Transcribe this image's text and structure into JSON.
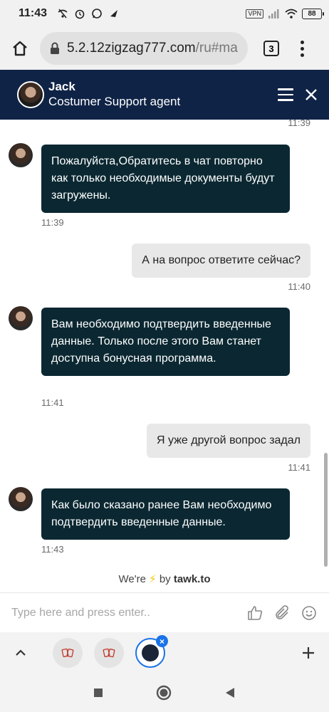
{
  "status_bar": {
    "time": "11:43",
    "vpn": "VPN",
    "battery": "88"
  },
  "browser": {
    "url_host": "5.2.12zigzag777.com",
    "url_path": "/ru#ma",
    "tab_count": "3"
  },
  "chat_header": {
    "agent_name": "Jack",
    "agent_role": "Costumer Support agent"
  },
  "messages": [
    {
      "from": "agent",
      "time": "11:39",
      "text": "Пожалуйста,Обратитесь в чат повторно как только необходимые документы будут загружены."
    },
    {
      "from": "user",
      "time": "11:40",
      "text": "А на вопрос ответите сейчас?"
    },
    {
      "from": "agent",
      "time": "11:41",
      "text": "Вам необходимо подтвердить введенные данные. Только после этого Вам станет доступна бонусная программа."
    },
    {
      "from": "user",
      "time": "11:41",
      "text": "Я уже другой вопрос задал"
    },
    {
      "from": "agent",
      "time": "11:43",
      "text": "Как было сказано ранее Вам необходимо подтвердить введенные данные."
    }
  ],
  "top_timestamp": "11:39",
  "powered_by": {
    "prefix": "We're",
    "by": "by",
    "brand": "tawk.to"
  },
  "input": {
    "placeholder": "Type here and press enter.."
  },
  "colors": {
    "header_bg": "#0f2346",
    "agent_bubble": "#0b2832",
    "user_bubble": "#e8e8e8",
    "active_tab": "#1a73e8"
  }
}
